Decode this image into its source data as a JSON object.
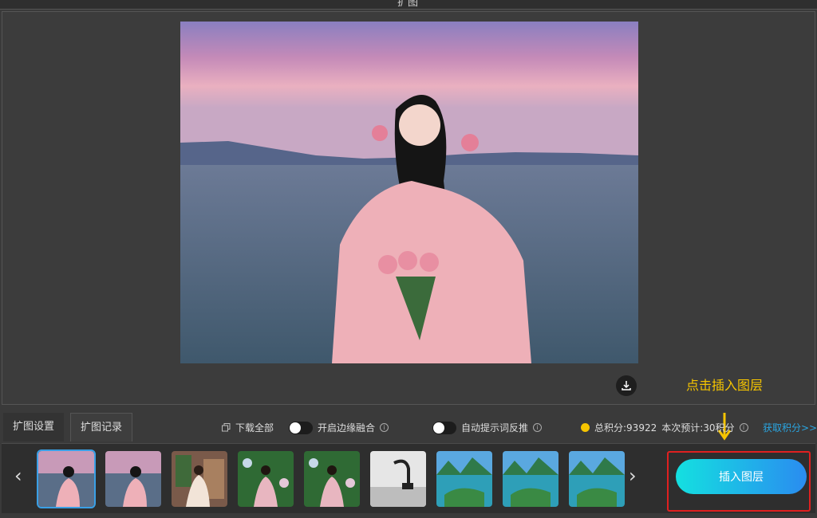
{
  "window": {
    "title": "扩图"
  },
  "annotation": {
    "text": "点击插入图层"
  },
  "tabs": {
    "settings": "扩图设置",
    "records": "扩图记录"
  },
  "toolbar": {
    "download_all": "下载全部",
    "edge_blend": "开启边缘融合",
    "prompt_reverse": "自动提示词反推",
    "total_points": "总积分:93922",
    "estimate": "本次预计:30积分",
    "get_points": "获取积分>>"
  },
  "insert_button": {
    "label": "插入图层"
  },
  "thumbnails": [
    {
      "name": "woman-rose-sunset",
      "selected": true
    },
    {
      "name": "woman-rose-sunset-2",
      "selected": false
    },
    {
      "name": "woman-christmas-room",
      "selected": false
    },
    {
      "name": "woman-flower-wall",
      "selected": false
    },
    {
      "name": "woman-flower-wall-2",
      "selected": false
    },
    {
      "name": "bathroom-faucet",
      "selected": false
    },
    {
      "name": "karst-river-landscape",
      "selected": false
    },
    {
      "name": "karst-river-landscape-2",
      "selected": false
    },
    {
      "name": "karst-river-landscape-3",
      "selected": false
    }
  ],
  "colors": {
    "accent": "#2aa5e0",
    "annotation": "#f5c400",
    "highlight_frame": "#e02020"
  }
}
